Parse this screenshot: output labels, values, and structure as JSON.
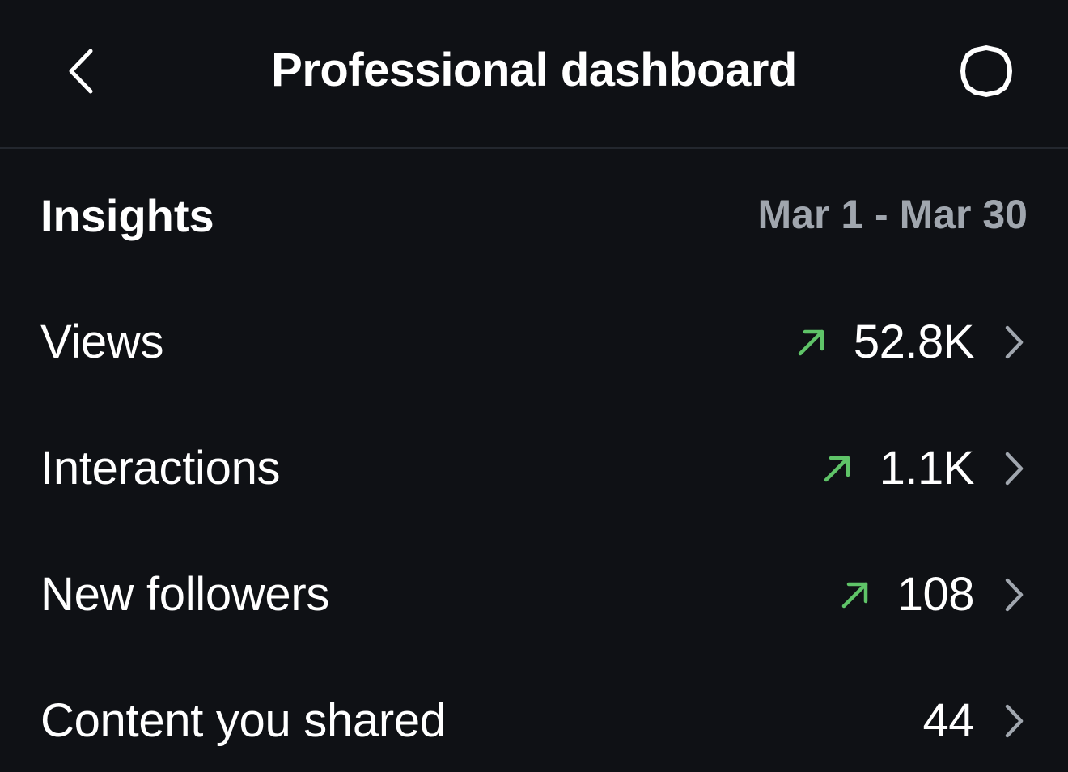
{
  "header": {
    "title": "Professional dashboard",
    "back_icon": "chevron-left-icon",
    "settings_icon": "gear-icon"
  },
  "insights": {
    "title": "Insights",
    "date_range": "Mar 1 - Mar 30"
  },
  "metrics": [
    {
      "label": "Views",
      "value": "52.8K",
      "trend": "up"
    },
    {
      "label": "Interactions",
      "value": "1.1K",
      "trend": "up"
    },
    {
      "label": "New followers",
      "value": "108",
      "trend": "up"
    },
    {
      "label": "Content you shared",
      "value": "44",
      "trend": "none"
    }
  ],
  "colors": {
    "background": "#0f1115",
    "text_primary": "#ffffff",
    "text_secondary": "#a0a6ae",
    "trend_up": "#5fc468",
    "divider": "#23272e",
    "chevron": "#a0a6ae"
  }
}
